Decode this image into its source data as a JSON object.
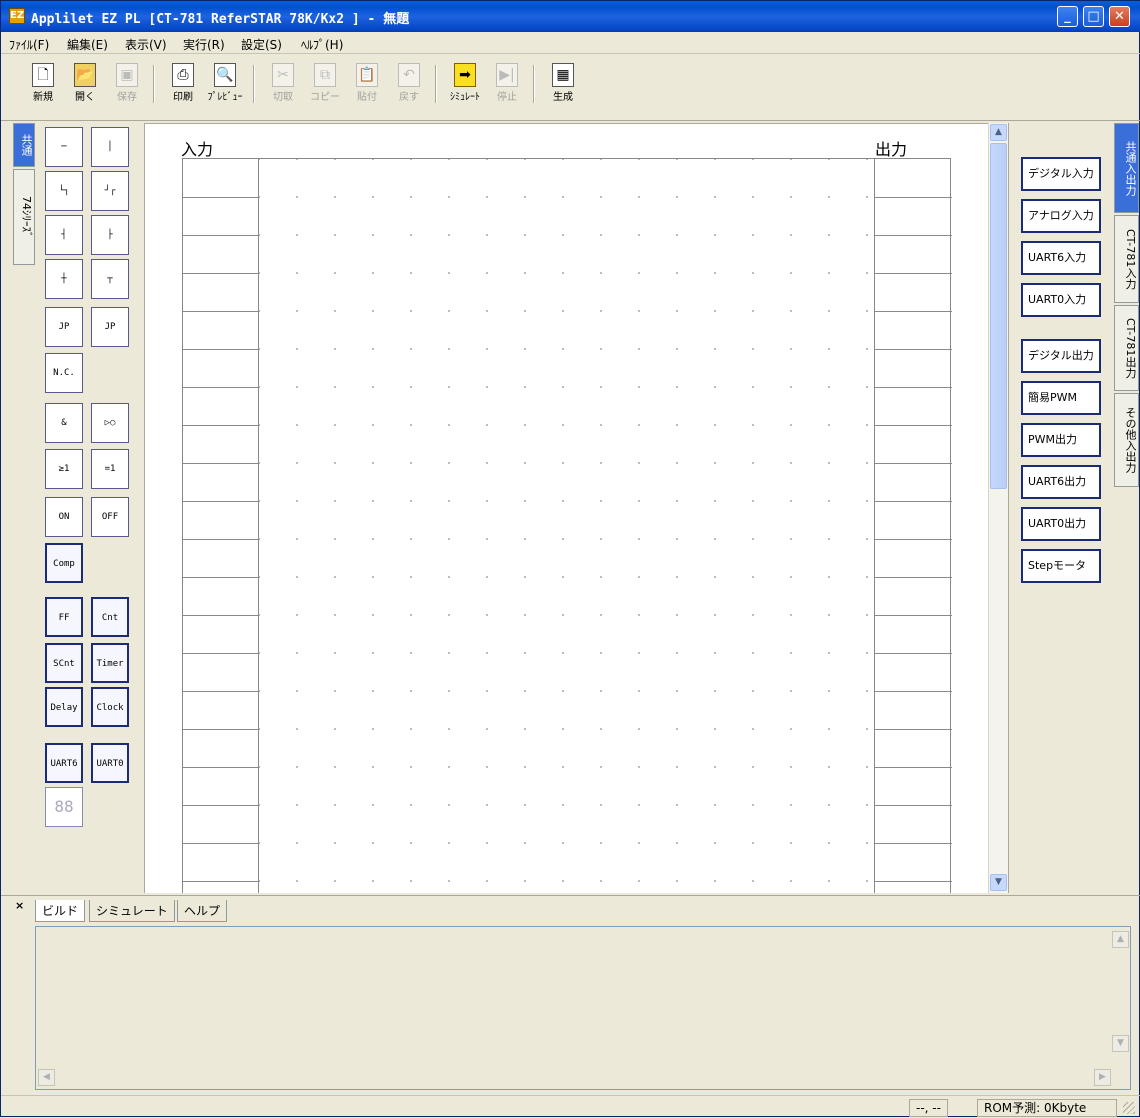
{
  "window": {
    "title": "Applilet EZ PL [CT-781 ReferSTAR 78K/Kx2 ] - 無題",
    "app_icon_glyph": "EZ"
  },
  "menu": [
    "ﾌｧｲﾙ(F)",
    "編集(E)",
    "表示(V)",
    "実行(R)",
    "設定(S)",
    "ﾍﾙﾌﾟ(H)"
  ],
  "toolbar": {
    "new": "新規",
    "open": "開く",
    "save": "保存",
    "print": "印刷",
    "preview": "ﾌﾟﾚﾋﾞｭｰ",
    "cut": "切取",
    "copy": "コピー",
    "paste": "貼付",
    "undo": "戻す",
    "simulate": "ｼﾐｭﾚｰﾄ",
    "stop": "停止",
    "generate": "生成"
  },
  "left_tabs": {
    "common": "共通",
    "series74": "74ｼﾘｰｽﾞ"
  },
  "palette": {
    "jp_in": "JP",
    "jp_out": "JP",
    "nc": "N.C.",
    "on": "ON",
    "off": "OFF",
    "comp": "Comp",
    "ff": "FF",
    "cnt": "Cnt",
    "scnt": "SCnt",
    "timer": "Timer",
    "delay": "Delay",
    "clock": "Clock",
    "uart6": "UART6",
    "uart0": "UART0",
    "seg": "88"
  },
  "canvas": {
    "input_label": "入力",
    "output_label": "出力"
  },
  "io_panel": [
    "デジタル入力",
    "アナログ入力",
    "UART6入力",
    "UART0入力",
    "デジタル出力",
    "簡易PWM",
    "PWM出力",
    "UART6出力",
    "UART0出力",
    "Stepモータ"
  ],
  "right_tabs": {
    "common_io": "共通入出力",
    "ct781_in": "CT-781入力",
    "ct781_out": "CT-781出力",
    "other_io": "その他入出力"
  },
  "bottom_tabs": {
    "build": "ビルド",
    "simulate": "シミュレート",
    "help": "ヘルプ"
  },
  "status": {
    "position": "--, --",
    "rom": "ROM予測:  0Kbyte"
  }
}
